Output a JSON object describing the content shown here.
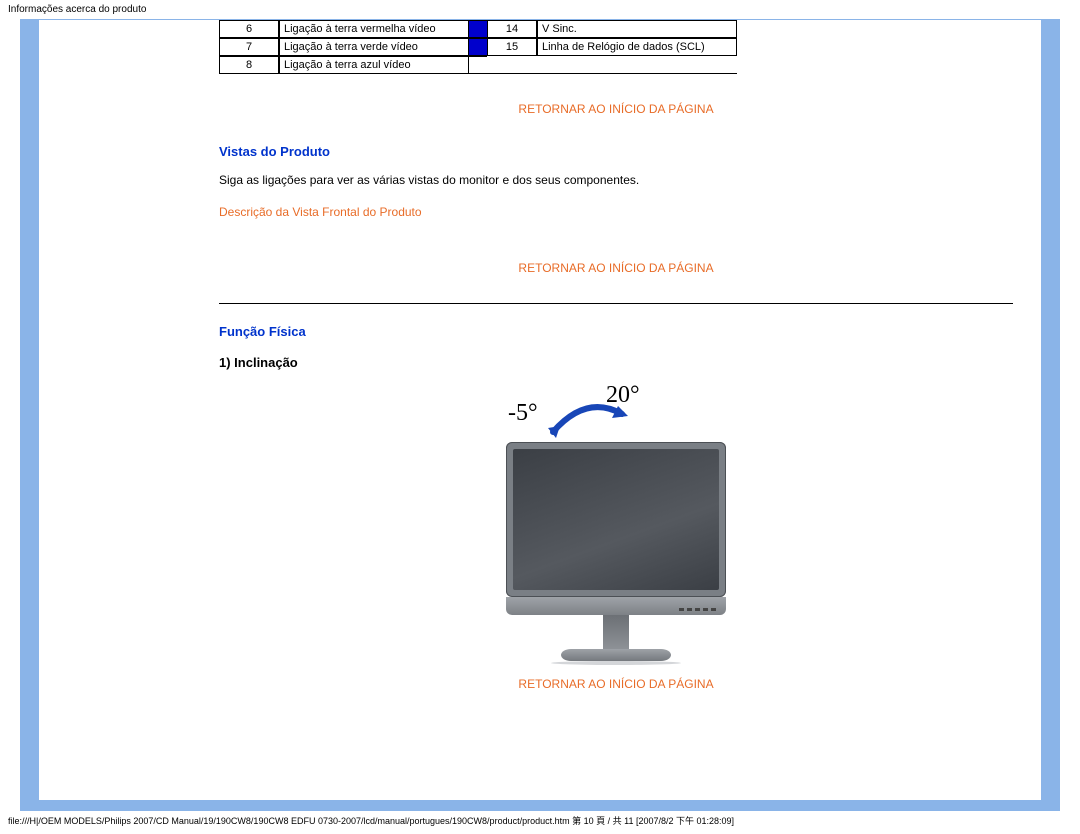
{
  "page_header": "Informações acerca do produto",
  "file_path": "file:///H|/OEM MODELS/Philips 2007/CD Manual/19/190CW8/190CW8 EDFU 0730-2007/lcd/manual/portugues/190CW8/product/product.htm 第 10 頁 / 共 11  [2007/8/2 下午 01:28:09]",
  "pin_table": {
    "rows": [
      {
        "left_num": "6",
        "left_desc": "Ligação à terra vermelha vídeo",
        "right_num": "14",
        "right_desc": "V Sinc."
      },
      {
        "left_num": "7",
        "left_desc": "Ligação à terra verde vídeo",
        "right_num": "15",
        "right_desc": "Linha de Relógio de dados (SCL)"
      },
      {
        "left_num": "8",
        "left_desc": "Ligação à terra azul vídeo",
        "right_num": "",
        "right_desc": ""
      }
    ]
  },
  "return_link": "RETORNAR AO INÍCIO DA PÁGINA",
  "sections": {
    "vistas_title": "Vistas do Produto",
    "vistas_text": "Siga as ligações para ver as várias vistas do monitor e dos seus componentes.",
    "front_view_link": "Descrição da Vista Frontal do Produto",
    "funcao_title": "Função Física",
    "inclinacao_sub": "1) Inclinação"
  },
  "tilt": {
    "neg": "-5°",
    "pos": "20°"
  }
}
